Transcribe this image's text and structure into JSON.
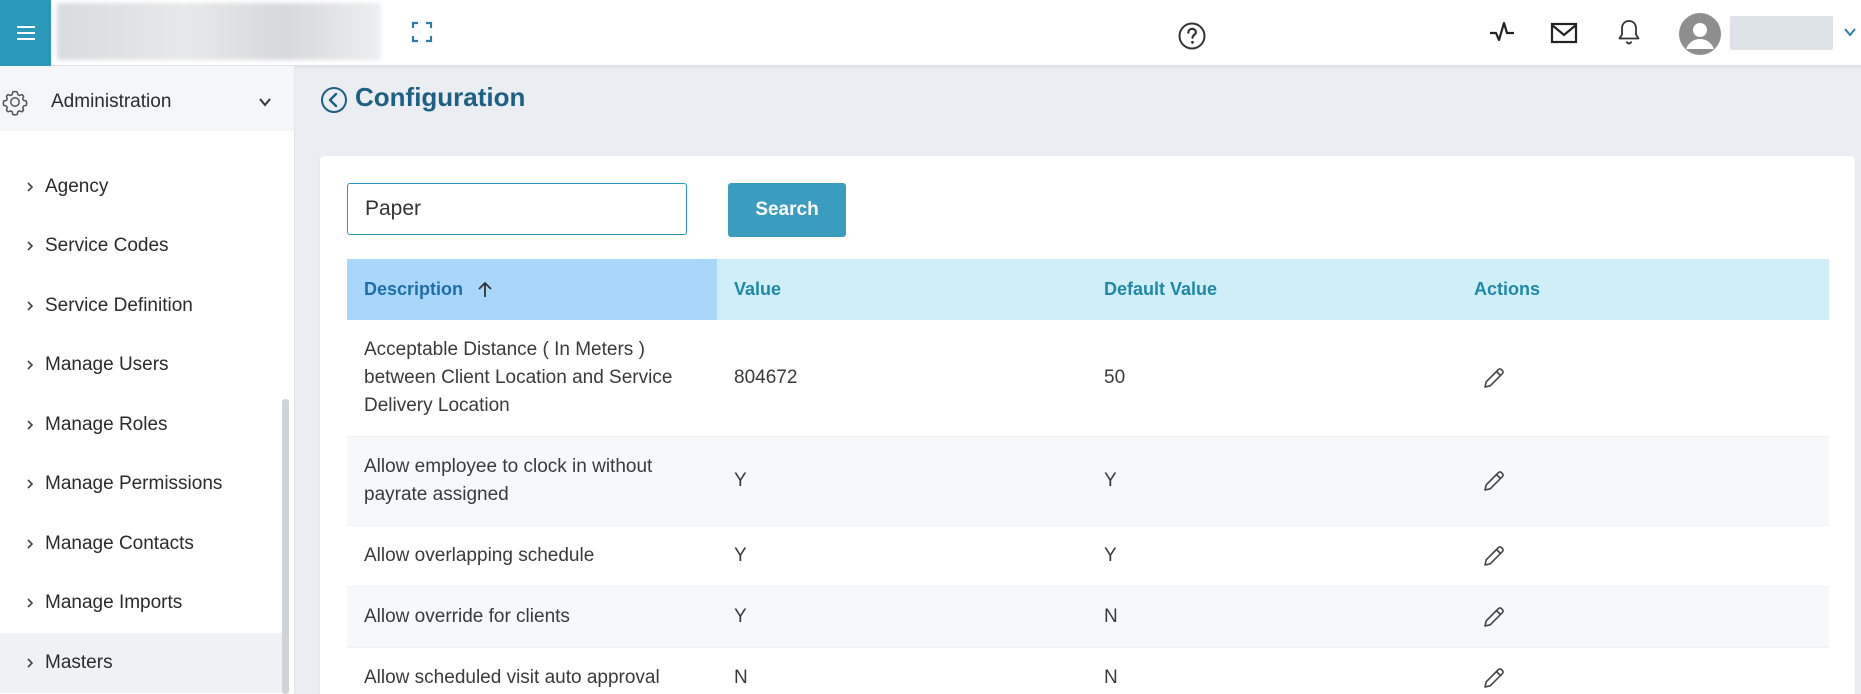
{
  "header": {
    "icons": {
      "menu": "hamburger-menu-icon",
      "expand": "fullscreen-icon",
      "help": "help-icon",
      "activity": "activity-icon",
      "mail": "mail-icon",
      "notifications": "bell-icon",
      "user": "user-avatar-icon"
    }
  },
  "sidebar": {
    "section_label": "Administration",
    "items": [
      {
        "label": "Agency"
      },
      {
        "label": "Service Codes"
      },
      {
        "label": "Service Definition"
      },
      {
        "label": "Manage Users"
      },
      {
        "label": "Manage Roles"
      },
      {
        "label": "Manage Permissions"
      },
      {
        "label": "Manage Contacts"
      },
      {
        "label": "Manage Imports"
      },
      {
        "label": "Masters"
      }
    ]
  },
  "main": {
    "title": "Configuration",
    "search": {
      "value": "Paper",
      "button_label": "Search"
    },
    "table": {
      "columns": [
        "Description",
        "Value",
        "Default Value",
        "Actions"
      ],
      "sorted_column": "Description",
      "sort_direction": "ascending",
      "rows": [
        {
          "description": "Acceptable Distance ( In Meters ) between Client Location and Service Delivery Location",
          "value": "804672",
          "default_value": "50"
        },
        {
          "description": "Allow employee to clock in without payrate assigned",
          "value": "Y",
          "default_value": "Y"
        },
        {
          "description": "Allow overlapping schedule",
          "value": "Y",
          "default_value": "Y"
        },
        {
          "description": "Allow override for clients",
          "value": "Y",
          "default_value": "N"
        },
        {
          "description": "Allow scheduled visit auto approval",
          "value": "N",
          "default_value": "N"
        }
      ]
    }
  },
  "colors": {
    "accent": "#2a98b8",
    "title": "#1e5f86",
    "header_row": "#cfeef8",
    "sorted_header": "#a9d6fb"
  }
}
